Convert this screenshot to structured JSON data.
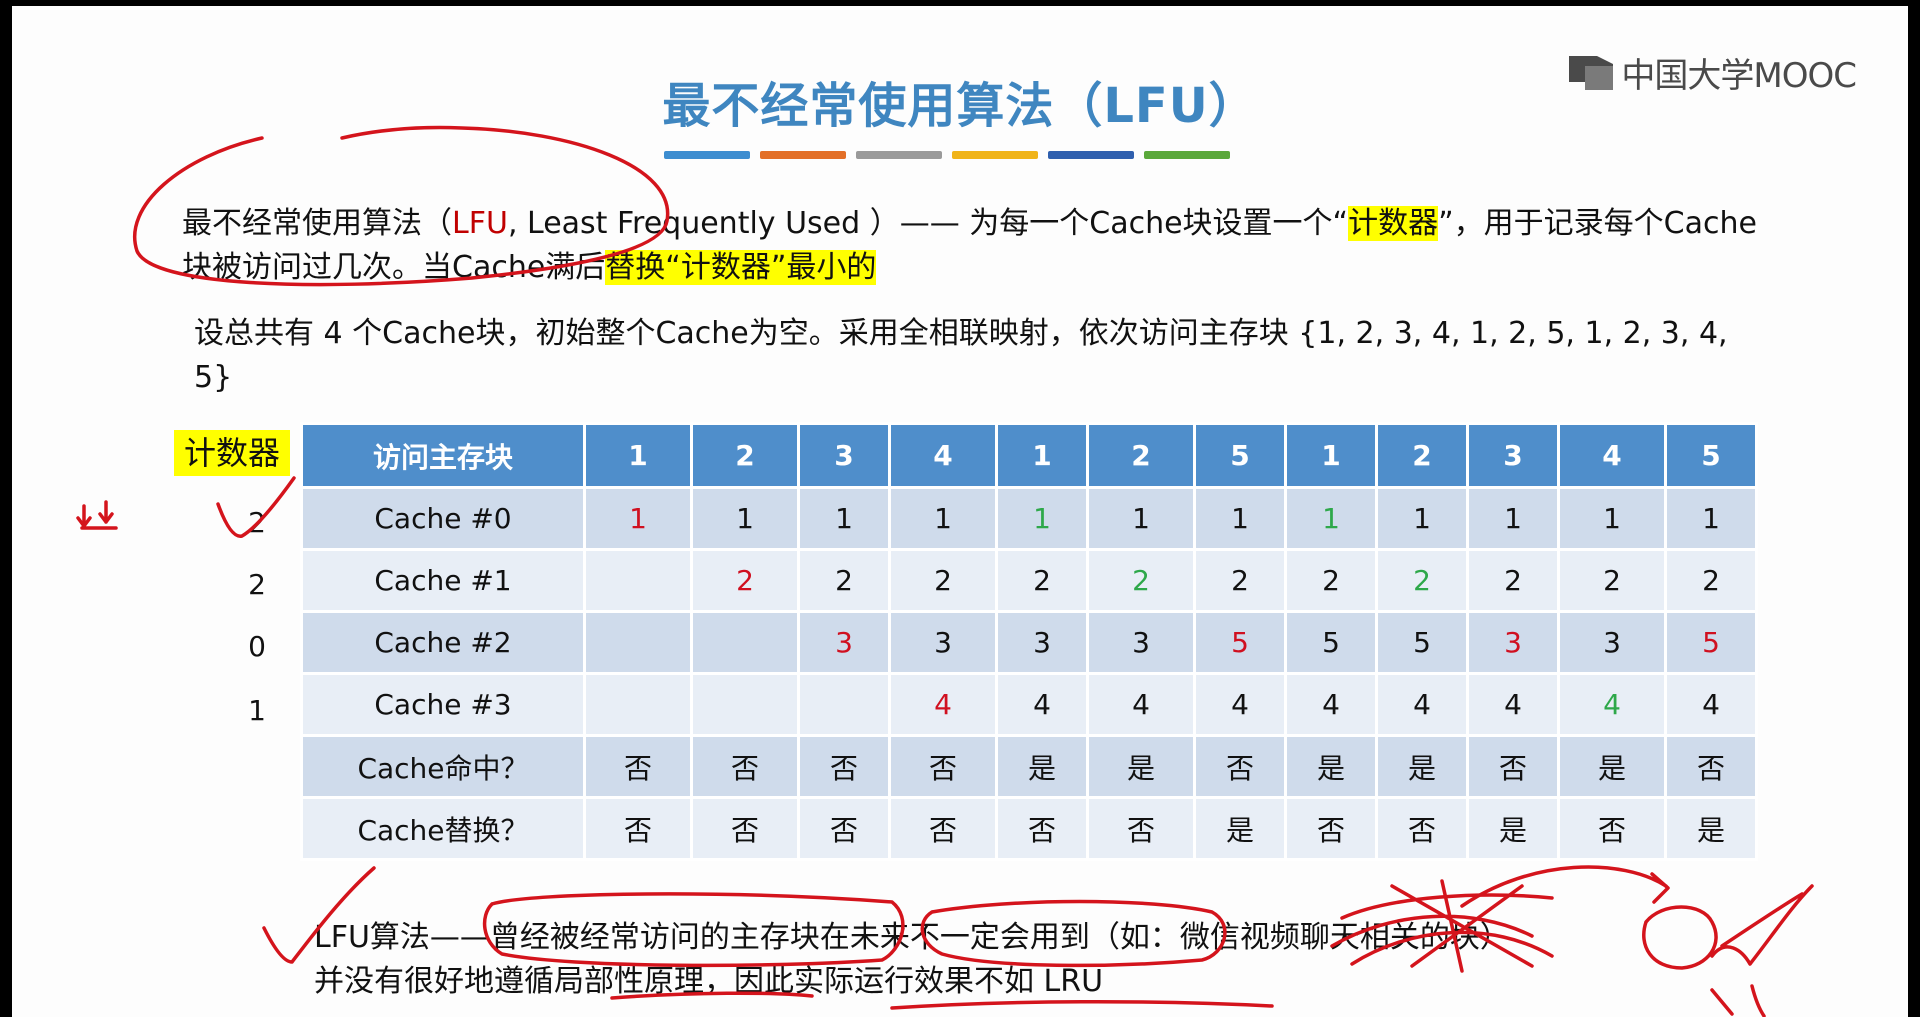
{
  "slide": {
    "title": "最不经常使用算法（LFU）",
    "title_bar_colors": [
      "#3d8dd0",
      "#e36f27",
      "#9a9a9a",
      "#f0b419",
      "#2f5fae",
      "#5aa83a"
    ],
    "logo_text": "中国大学MOOC",
    "logo_icon": "mooc-book-icon"
  },
  "para1": {
    "text_a": "最不经常使用算法（",
    "text_lfu": "LFU",
    "text_b": ", Least Frequently Used ）—— 为每一个Cache块设置一个“",
    "text_hl1": "计数器",
    "text_c": "”，用于记录每个Cache块被访问过几次。当Cache满后",
    "text_hl2": "替换“计数器”最小的"
  },
  "para2": {
    "text": "设总共有 4 个Cache块，初始整个Cache为空。采用全相联映射，依次访问主存块 {1, 2, 3, 4, 1, 2, 5, 1, 2, 3, 4, 5}"
  },
  "counter": {
    "label": "计数器",
    "values": [
      "2",
      "2",
      "0",
      "1"
    ]
  },
  "table": {
    "header_label": "访问主存块",
    "accesses": [
      "1",
      "2",
      "3",
      "4",
      "1",
      "2",
      "5",
      "1",
      "2",
      "3",
      "4",
      "5"
    ],
    "rows": [
      {
        "label": "Cache #0",
        "cells": [
          {
            "v": "1",
            "c": "red"
          },
          {
            "v": "1",
            "c": ""
          },
          {
            "v": "1",
            "c": ""
          },
          {
            "v": "1",
            "c": ""
          },
          {
            "v": "1",
            "c": "green"
          },
          {
            "v": "1",
            "c": ""
          },
          {
            "v": "1",
            "c": ""
          },
          {
            "v": "1",
            "c": "green"
          },
          {
            "v": "1",
            "c": ""
          },
          {
            "v": "1",
            "c": ""
          },
          {
            "v": "1",
            "c": ""
          },
          {
            "v": "1",
            "c": ""
          }
        ]
      },
      {
        "label": "Cache #1",
        "cells": [
          {
            "v": "",
            "c": ""
          },
          {
            "v": "2",
            "c": "red"
          },
          {
            "v": "2",
            "c": ""
          },
          {
            "v": "2",
            "c": ""
          },
          {
            "v": "2",
            "c": ""
          },
          {
            "v": "2",
            "c": "green"
          },
          {
            "v": "2",
            "c": ""
          },
          {
            "v": "2",
            "c": ""
          },
          {
            "v": "2",
            "c": "green"
          },
          {
            "v": "2",
            "c": ""
          },
          {
            "v": "2",
            "c": ""
          },
          {
            "v": "2",
            "c": ""
          }
        ]
      },
      {
        "label": "Cache #2",
        "cells": [
          {
            "v": "",
            "c": ""
          },
          {
            "v": "",
            "c": ""
          },
          {
            "v": "3",
            "c": "red"
          },
          {
            "v": "3",
            "c": ""
          },
          {
            "v": "3",
            "c": ""
          },
          {
            "v": "3",
            "c": ""
          },
          {
            "v": "5",
            "c": "red"
          },
          {
            "v": "5",
            "c": ""
          },
          {
            "v": "5",
            "c": ""
          },
          {
            "v": "3",
            "c": "red"
          },
          {
            "v": "3",
            "c": ""
          },
          {
            "v": "5",
            "c": "red"
          }
        ]
      },
      {
        "label": "Cache #3",
        "cells": [
          {
            "v": "",
            "c": ""
          },
          {
            "v": "",
            "c": ""
          },
          {
            "v": "",
            "c": ""
          },
          {
            "v": "4",
            "c": "red"
          },
          {
            "v": "4",
            "c": ""
          },
          {
            "v": "4",
            "c": ""
          },
          {
            "v": "4",
            "c": ""
          },
          {
            "v": "4",
            "c": ""
          },
          {
            "v": "4",
            "c": ""
          },
          {
            "v": "4",
            "c": ""
          },
          {
            "v": "4",
            "c": "green"
          },
          {
            "v": "4",
            "c": ""
          }
        ]
      },
      {
        "label": "Cache命中？",
        "cells": [
          {
            "v": "否",
            "c": ""
          },
          {
            "v": "否",
            "c": ""
          },
          {
            "v": "否",
            "c": ""
          },
          {
            "v": "否",
            "c": ""
          },
          {
            "v": "是",
            "c": ""
          },
          {
            "v": "是",
            "c": ""
          },
          {
            "v": "否",
            "c": ""
          },
          {
            "v": "是",
            "c": ""
          },
          {
            "v": "是",
            "c": ""
          },
          {
            "v": "否",
            "c": ""
          },
          {
            "v": "是",
            "c": ""
          },
          {
            "v": "否",
            "c": ""
          }
        ]
      },
      {
        "label": "Cache替换？",
        "cells": [
          {
            "v": "否",
            "c": ""
          },
          {
            "v": "否",
            "c": ""
          },
          {
            "v": "否",
            "c": ""
          },
          {
            "v": "否",
            "c": ""
          },
          {
            "v": "否",
            "c": ""
          },
          {
            "v": "否",
            "c": ""
          },
          {
            "v": "是",
            "c": ""
          },
          {
            "v": "否",
            "c": ""
          },
          {
            "v": "否",
            "c": ""
          },
          {
            "v": "是",
            "c": ""
          },
          {
            "v": "否",
            "c": ""
          },
          {
            "v": "是",
            "c": ""
          }
        ]
      }
    ],
    "colors": {
      "header_bg": "#4f8ecb",
      "row_dark": "#cfdbeb",
      "row_light": "#e8eef6",
      "red": "#d01020",
      "green": "#2ea84a"
    }
  },
  "footer": {
    "line1": "LFU算法——曾经被经常访问的主存块在未来不一定会用到（如：微信视频聊天相关的块）",
    "line2": "并没有很好地遵循局部性原理，因此实际运行效果不如 LRU"
  },
  "annotations": {
    "ink_color": "#d4141c"
  }
}
